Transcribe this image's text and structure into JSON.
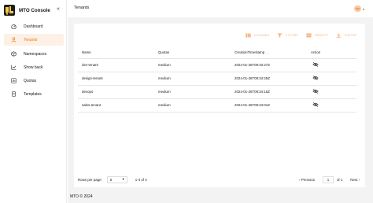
{
  "brand": {
    "name": "MTO Console"
  },
  "sidebar": {
    "collapse_icon": "double-chevron-left-icon",
    "items": [
      {
        "label": "Dashboard",
        "icon": "dashboard-icon",
        "active": false
      },
      {
        "label": "Tenants",
        "icon": "tenants-icon",
        "active": true
      },
      {
        "label": "Namespaces",
        "icon": "namespaces-icon",
        "active": false
      },
      {
        "label": "Show back",
        "icon": "showback-icon",
        "active": false
      },
      {
        "label": "Quotas",
        "icon": "quotas-icon",
        "active": false
      },
      {
        "label": "Templates",
        "icon": "templates-icon",
        "active": false
      }
    ]
  },
  "header": {
    "title": "Tenants",
    "avatar_initials": "AM"
  },
  "toolbar": {
    "columns_label": "COLUMNS",
    "filters_label": "FILTERS",
    "density_label": "DENSITY",
    "export_label": "EXPORT"
  },
  "table": {
    "headers": {
      "name": "Name",
      "quotas": "Quotas",
      "timestamp": "CreationTimestamp",
      "action": "Action"
    },
    "rows": [
      {
        "name": "dev-tenant",
        "quotas": "medium",
        "timestamp": "2024-01-26T09:40:27Z"
      },
      {
        "name": "design-tenant",
        "quotas": "medium",
        "timestamp": "2024-01-26T09:34:25Z"
      },
      {
        "name": "devops",
        "quotas": "medium",
        "timestamp": "2024-01-26T09:34:15Z"
      },
      {
        "name": "sales-tenant",
        "quotas": "medium",
        "timestamp": "2024-01-26T09:34:01Z"
      }
    ]
  },
  "pagination": {
    "rows_per_page_label": "Rows per page:",
    "rows_per_page_value": "5",
    "range_text": "1-4 of 4",
    "previous_label": "Previous",
    "page_value": "1",
    "of_label": "of 1",
    "next_label": "Next"
  },
  "footer": {
    "text": "MTO © 2024"
  },
  "colors": {
    "accent": "#ec7a08",
    "accent_light": "#fdf0e6",
    "muted_accent": "#f4b07a",
    "background": "#f3f3f3"
  }
}
